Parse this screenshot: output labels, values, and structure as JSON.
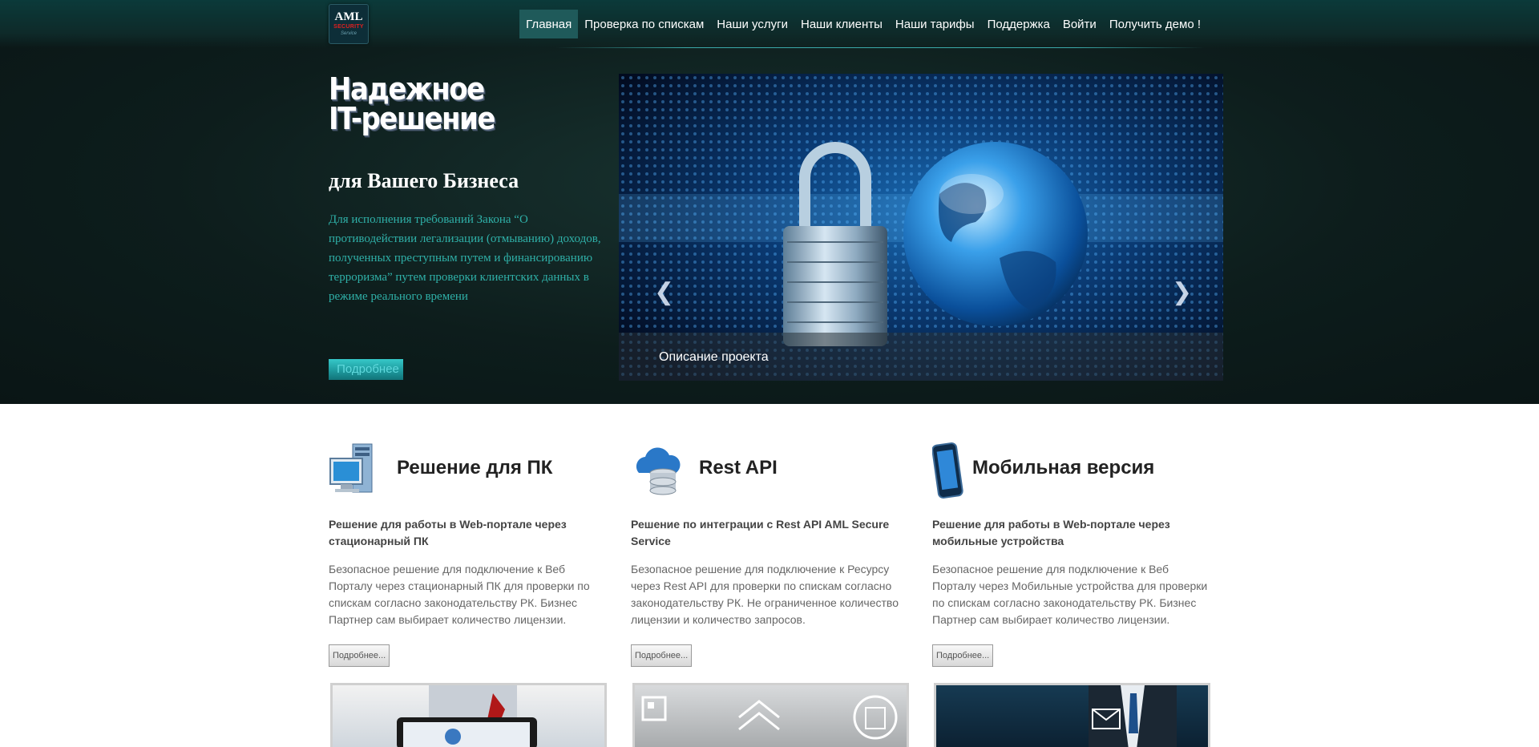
{
  "logo": {
    "main": "AML",
    "sub": "SECURITY",
    "tag": "Service"
  },
  "nav": [
    {
      "label": "Главная",
      "active": true
    },
    {
      "label": "Проверка по спискам"
    },
    {
      "label": "Наши услуги"
    },
    {
      "label": "Наши клиенты"
    },
    {
      "label": "Наши тарифы"
    },
    {
      "label": "Поддержка"
    },
    {
      "label": "Войти"
    },
    {
      "label": "Получить демо !"
    }
  ],
  "hero": {
    "title_line1": "Надежное",
    "title_line2": "IT-решение",
    "subtitle": "для Вашего Бизнеса",
    "description": "Для исполнения требований Закона “О противодействии легализации (отмыванию) доходов, полученных преступным путем и финансированию терроризма” путем проверки клиентских данных в режиме реального времени",
    "button": "Подробнее"
  },
  "carousel": {
    "caption": "Описание проекта",
    "prev_icon": "chevron-left-icon",
    "next_icon": "chevron-right-icon"
  },
  "features": [
    {
      "icon": "desktop-computer-icon",
      "title": "Решение для ПК",
      "subtitle": "Решение для работы в Web-портале через стационарный ПК",
      "text": "Безопасное решение для подключение к Веб Порталу через стационарный ПК для проверки по спискам согласно законодательству РК. Бизнес Партнер сам выбирает количество лицензии.",
      "button": "Подробнее..."
    },
    {
      "icon": "cloud-database-icon",
      "title": "Rest API",
      "subtitle": "Решение по интеграции с Rest API AML Secure Service",
      "text": "Безопасное решение для подключение к Ресурсу через Rest API для проверки по спискам согласно законодательству РК. Не ограниченное количество лицензии и количество запросов.",
      "button": "Подробнее..."
    },
    {
      "icon": "smartphone-icon",
      "title": "Мобильная версия",
      "subtitle": "Решение для работы в Web-портале через мобильные устройства",
      "text": "Безопасное решение для подключение к Веб Порталу через Мобильные устройства для проверки по спискам согласно законодательству РК. Бизнес Партнер сам выбирает количество лицензии.",
      "button": "Подробнее..."
    }
  ],
  "colors": {
    "hero_bg": "#0d1d1c",
    "accent": "#2fb0a8",
    "nav_active": "#1f5a5a"
  }
}
